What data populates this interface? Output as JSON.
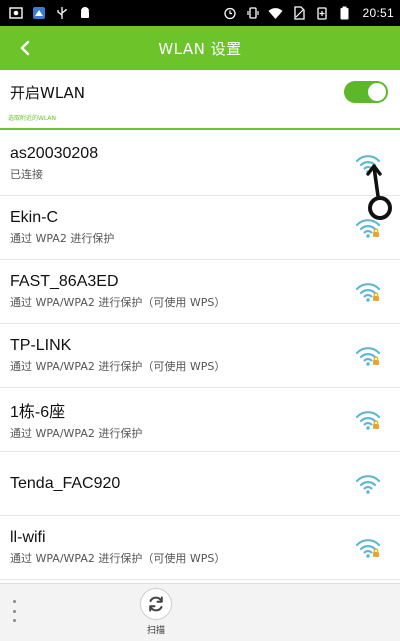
{
  "status_bar": {
    "time": "20:51",
    "left_icons": [
      "image-icon",
      "app-icon",
      "usb-icon",
      "android-icon"
    ],
    "right_icons": [
      "alarm-icon",
      "vibrate-icon",
      "wifi-signal-icon",
      "no-sim-icon",
      "battery-saver-icon",
      "battery-icon"
    ]
  },
  "header": {
    "title": "WLAN 设置",
    "back_icon": "chevron-left-icon",
    "color": "#6cc42a"
  },
  "wlan_toggle": {
    "label": "开启WLAN",
    "enabled": true
  },
  "section": {
    "label": "选取附近的WLAN"
  },
  "networks": [
    {
      "name": "as20030208",
      "status": "已连接",
      "secured": false,
      "connected": true
    },
    {
      "name": "Ekin-C",
      "status": "通过 WPA2 进行保护",
      "secured": true,
      "connected": false
    },
    {
      "name": "FAST_86A3ED",
      "status": "通过 WPA/WPA2 进行保护（可使用 WPS）",
      "secured": true,
      "connected": false
    },
    {
      "name": "TP-LINK",
      "status": "通过 WPA/WPA2 进行保护（可使用 WPS）",
      "secured": true,
      "connected": false
    },
    {
      "name": "1栋-6座",
      "status": "通过 WPA/WPA2 进行保护",
      "secured": true,
      "connected": false
    },
    {
      "name": "Tenda_FAC920",
      "status": "",
      "secured": false,
      "connected": false
    },
    {
      "name": "ll-wifi",
      "status": "通过 WPA/WPA2 进行保护（可使用 WPS）",
      "secured": true,
      "connected": false
    }
  ],
  "bottom_bar": {
    "scan_label": "扫描",
    "menu_icon": "more-vertical-icon",
    "scan_icon": "refresh-icon"
  },
  "colors": {
    "accent": "#6cc42a",
    "wifi": "#5bb8d8",
    "lock": "#e9a52b"
  }
}
